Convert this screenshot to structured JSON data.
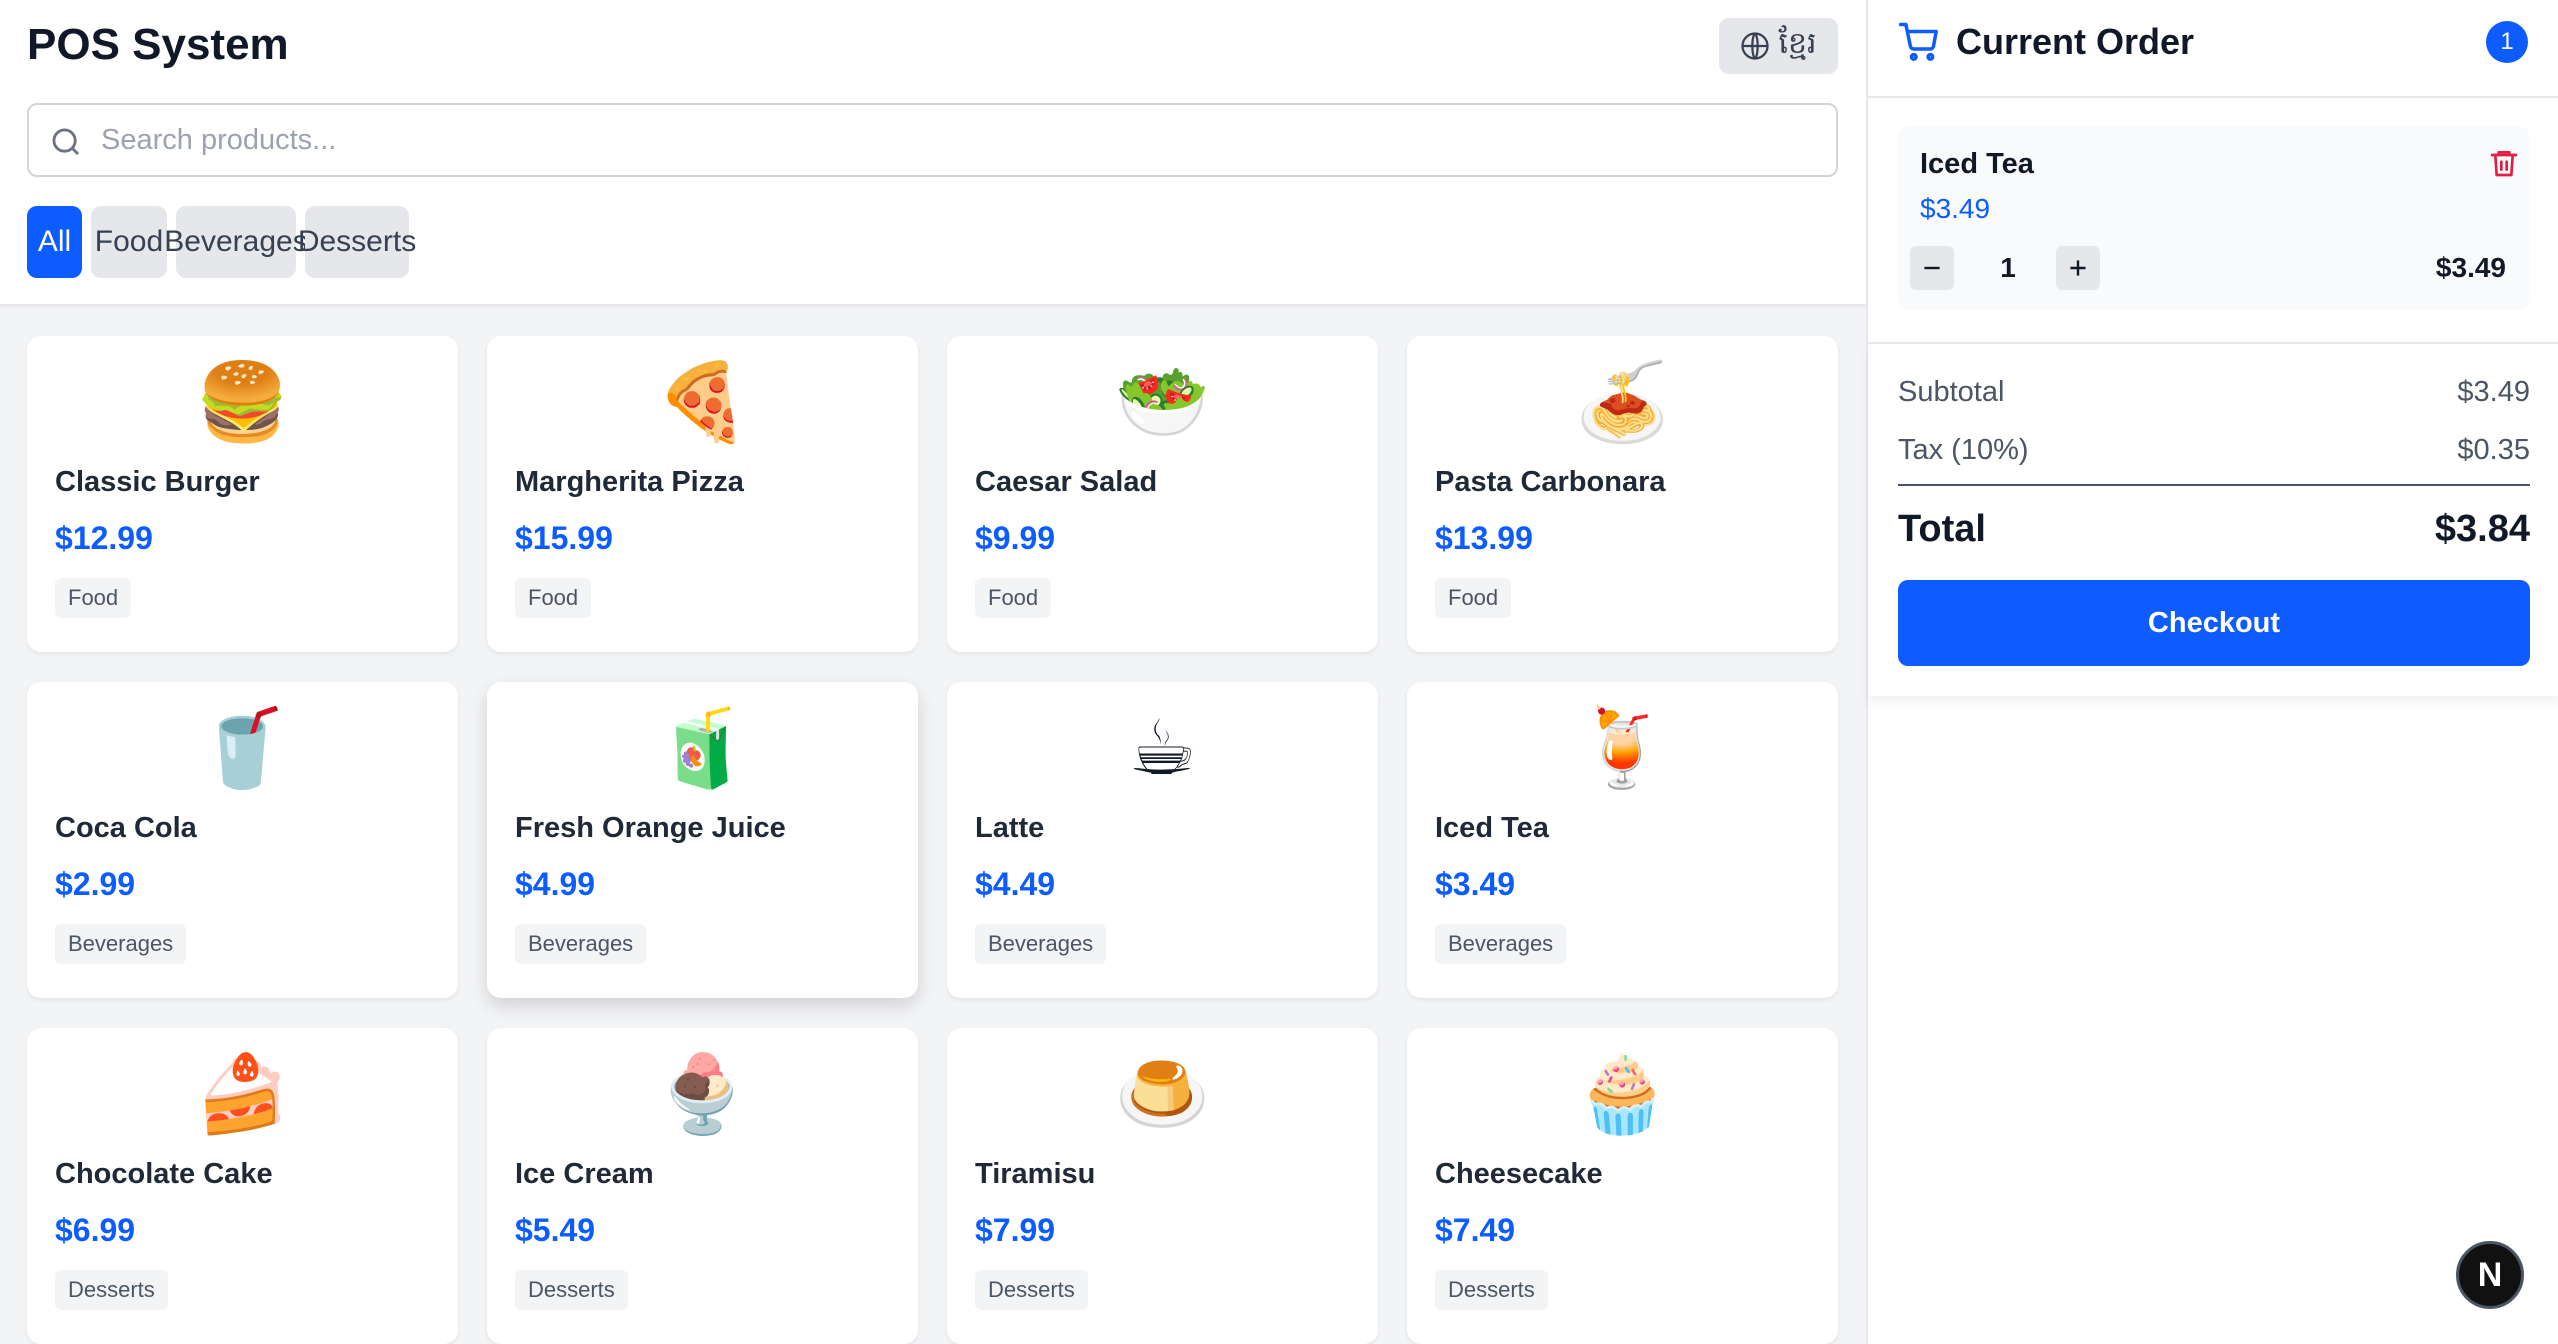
{
  "header": {
    "title": "POS System",
    "language_label": "ខ្មែរ",
    "search_placeholder": "Search products..."
  },
  "filters": [
    {
      "label": "All",
      "active": true
    },
    {
      "label": "Food",
      "active": false
    },
    {
      "label": "Beverages",
      "active": false
    },
    {
      "label": "Desserts",
      "active": false
    }
  ],
  "products": [
    {
      "emoji": "🍔",
      "name": "Classic Burger",
      "price": "$12.99",
      "category": "Food"
    },
    {
      "emoji": "🍕",
      "name": "Margherita Pizza",
      "price": "$15.99",
      "category": "Food"
    },
    {
      "emoji": "🥗",
      "name": "Caesar Salad",
      "price": "$9.99",
      "category": "Food"
    },
    {
      "emoji": "🍝",
      "name": "Pasta Carbonara",
      "price": "$13.99",
      "category": "Food"
    },
    {
      "emoji": "🥤",
      "name": "Coca Cola",
      "price": "$2.99",
      "category": "Beverages"
    },
    {
      "emoji": "🧃",
      "name": "Fresh Orange Juice",
      "price": "$4.99",
      "category": "Beverages"
    },
    {
      "emoji": "☕",
      "name": "Latte",
      "price": "$4.49",
      "category": "Beverages"
    },
    {
      "emoji": "🍹",
      "name": "Iced Tea",
      "price": "$3.49",
      "category": "Beverages"
    },
    {
      "emoji": "🍰",
      "name": "Chocolate Cake",
      "price": "$6.99",
      "category": "Desserts"
    },
    {
      "emoji": "🍨",
      "name": "Ice Cream",
      "price": "$5.49",
      "category": "Desserts"
    },
    {
      "emoji": "🍮",
      "name": "Tiramisu",
      "price": "$7.99",
      "category": "Desserts"
    },
    {
      "emoji": "🧁",
      "name": "Cheesecake",
      "price": "$7.49",
      "category": "Desserts"
    }
  ],
  "order": {
    "title": "Current Order",
    "count": "1",
    "items": [
      {
        "name": "Iced Tea",
        "unit_price": "$3.49",
        "quantity": "1",
        "line_total": "$3.49"
      }
    ],
    "subtotal_label": "Subtotal",
    "subtotal": "$3.49",
    "tax_label": "Tax (10%)",
    "tax": "$0.35",
    "total_label": "Total",
    "total": "$3.84",
    "checkout_label": "Checkout"
  },
  "dev_badge": "N",
  "colors": {
    "accent": "#0d5cff",
    "danger": "#e11d48"
  }
}
